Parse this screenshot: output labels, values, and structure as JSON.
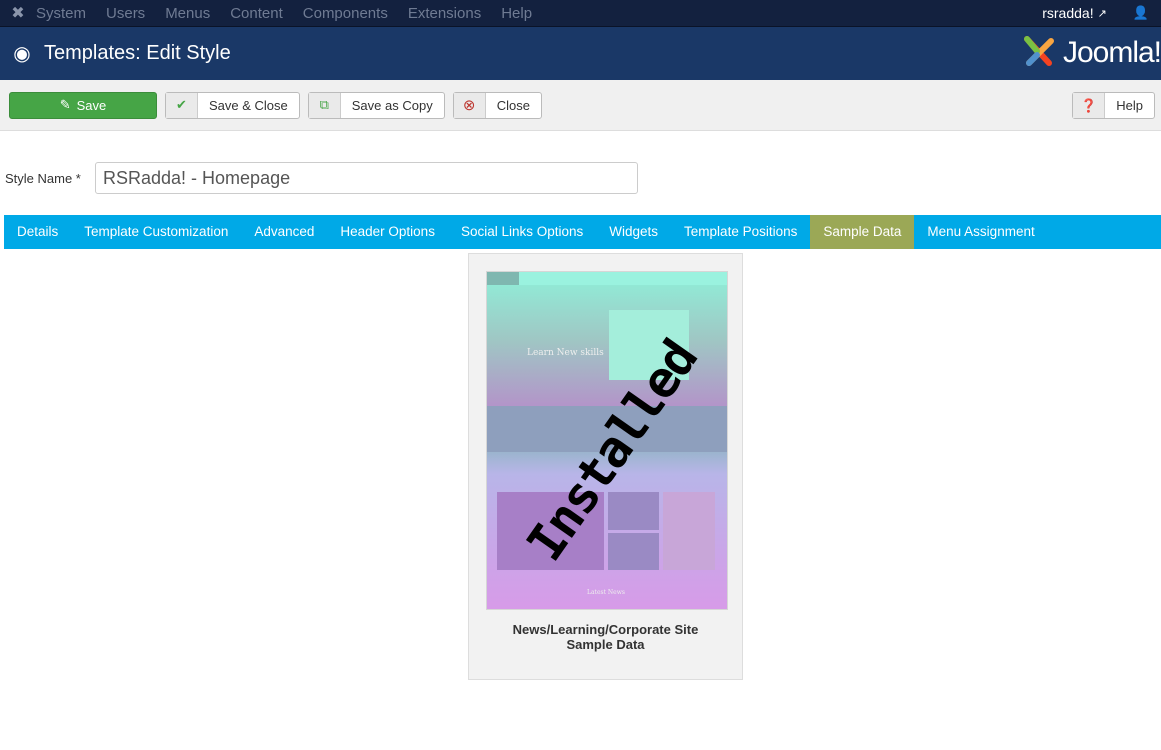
{
  "topbar": {
    "menus": [
      "System",
      "Users",
      "Menus",
      "Content",
      "Components",
      "Extensions",
      "Help"
    ],
    "username": "rsradda!"
  },
  "header": {
    "title": "Templates: Edit Style",
    "brand": "Joomla!"
  },
  "toolbar": {
    "save": "Save",
    "save_close": "Save & Close",
    "save_copy": "Save as Copy",
    "close": "Close",
    "help": "Help"
  },
  "form": {
    "label": "Style Name *",
    "value": "RSRadda! - Homepage"
  },
  "tabs": [
    "Details",
    "Template Customization",
    "Advanced",
    "Header Options",
    "Social Links Options",
    "Widgets",
    "Template Positions",
    "Sample Data",
    "Menu Assignment"
  ],
  "active_tab": "Sample Data",
  "sample": {
    "overlay": "Installed",
    "preview_heading": "Learn New skills",
    "preview_footer": "Latest News",
    "caption_line1": "News/Learning/Corporate Site",
    "caption_line2": "Sample Data"
  },
  "colors": {
    "save": "#46a546",
    "tabs": "#00a9e7",
    "active_tab": "#9ba856",
    "header": "#1a3867",
    "topbar": "#13213f"
  }
}
